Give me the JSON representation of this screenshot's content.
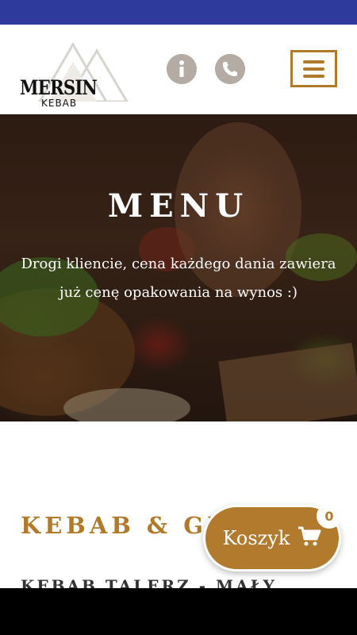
{
  "colors": {
    "top_bar": "#2e3b9c",
    "accent": "#b07a2a",
    "icon_grey": "#b4aca4"
  },
  "logo": {
    "main": "MERSIN",
    "sub": "KEBAB"
  },
  "header": {
    "icons": [
      "info-icon",
      "phone-icon",
      "hamburger-menu-icon"
    ]
  },
  "hero": {
    "title": "MENU",
    "text": "Drogi kliencie, cena każdego dania zawiera już cenę opakowania na wynos :)"
  },
  "section": {
    "heading": "KEBAB & GRILL",
    "first_item": "KEBAB TALERZ - MAŁY"
  },
  "cart": {
    "label": "Koszyk",
    "count": "0",
    "icon": "shopping-cart-icon"
  }
}
